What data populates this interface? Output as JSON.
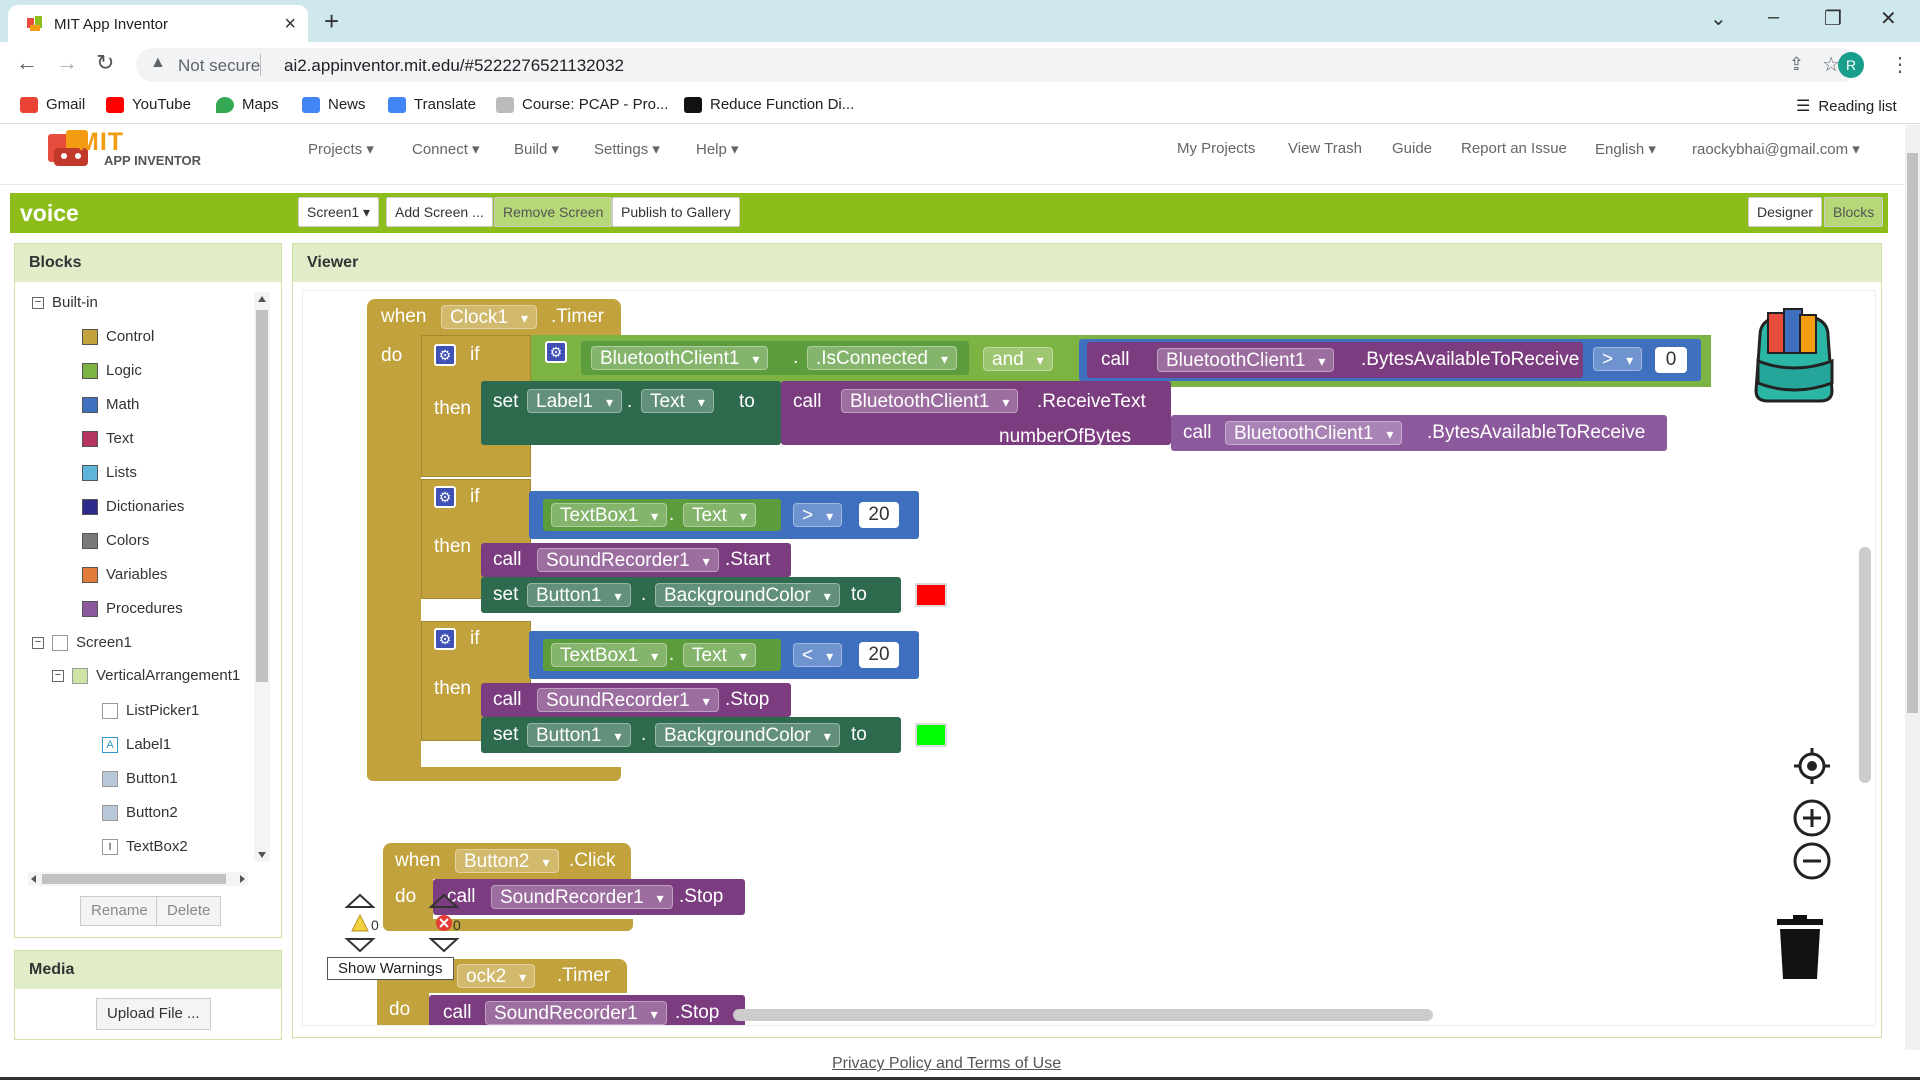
{
  "browser": {
    "tab_title": "MIT App Inventor",
    "not_secure": "Not secure",
    "url": "ai2.appinventor.mit.edu/#5222276521132032",
    "avatar": "R",
    "bookmarks": [
      "Gmail",
      "YouTube",
      "Maps",
      "News",
      "Translate",
      "Course: PCAP - Pro...",
      "Reduce Function Di..."
    ],
    "reading_list": "Reading list"
  },
  "app": {
    "logo_mit": "MIT",
    "logo_ai": "APP INVENTOR",
    "menus": [
      "Projects ▾",
      "Connect ▾",
      "Build ▾",
      "Settings ▾",
      "Help ▾"
    ],
    "right_menus": [
      "My Projects",
      "View Trash",
      "Guide",
      "Report an Issue",
      "English ▾",
      "raockybhai@gmail.com ▾"
    ]
  },
  "toolbar": {
    "project": "voice",
    "screen": "Screen1 ▾",
    "add_screen": "Add Screen ...",
    "remove_screen": "Remove Screen",
    "publish": "Publish to Gallery",
    "designer": "Designer",
    "blocks": "Blocks"
  },
  "blocks_panel": {
    "title": "Blocks",
    "builtin": "Built-in",
    "categories": [
      {
        "label": "Control",
        "color": "#c2a23c"
      },
      {
        "label": "Logic",
        "color": "#7cb342"
      },
      {
        "label": "Math",
        "color": "#3f6fbf"
      },
      {
        "label": "Text",
        "color": "#b5375f"
      },
      {
        "label": "Lists",
        "color": "#5fb4d9"
      },
      {
        "label": "Dictionaries",
        "color": "#2d2a8c"
      },
      {
        "label": "Colors",
        "color": "#7a7a7a"
      },
      {
        "label": "Variables",
        "color": "#e07b39"
      },
      {
        "label": "Procedures",
        "color": "#8c5a9c"
      }
    ],
    "screen": "Screen1",
    "arrangement": "VerticalArrangement1",
    "components": [
      "ListPicker1",
      "Label1",
      "Button1",
      "Button2",
      "TextBox2"
    ],
    "rename": "Rename",
    "delete": "Delete"
  },
  "media_panel": {
    "title": "Media",
    "upload": "Upload File ..."
  },
  "viewer": {
    "title": "Viewer",
    "b1": {
      "when": "when",
      "clock": "Clock1",
      ".timer": ".Timer",
      "do": "do",
      "if": "if",
      "then": "then",
      "bt": "BluetoothClient1",
      "isconn": ".IsConnected",
      "and": "and",
      "call": "call",
      "bytes": ".BytesAvailableToReceive",
      "gt": ">",
      "zero": "0",
      "set": "set",
      "label1": "Label1",
      "text_prop": "Text",
      "to": "to",
      "receive": ".ReceiveText",
      "numbytes": "numberOfBytes",
      "textbox": "TextBox1",
      "twenty": "20",
      "lt": "<",
      "recorder": "SoundRecorder1",
      "start": ".Start",
      "stop": ".Stop",
      "button1": "Button1",
      "bgcolor": "BackgroundColor",
      "dot": "."
    },
    "b2": {
      "when": "when",
      "button": "Button2",
      "click": ".Click",
      "do": "do",
      "call": "call",
      "recorder": "SoundRecorder1",
      "stop": ".Stop"
    },
    "b3": {
      "clock": "ock2",
      "timer": ".Timer",
      "do": "do",
      "call": "call",
      "recorder": "SoundRecorder1",
      "stop": ".Stop"
    },
    "warnings_count": "0",
    "errors_count": "0",
    "show_warnings": "Show Warnings",
    "colors": {
      "red": "#ff0000",
      "green": "#00ff00"
    }
  },
  "footer": {
    "privacy": "Privacy Policy and Terms of Use"
  }
}
